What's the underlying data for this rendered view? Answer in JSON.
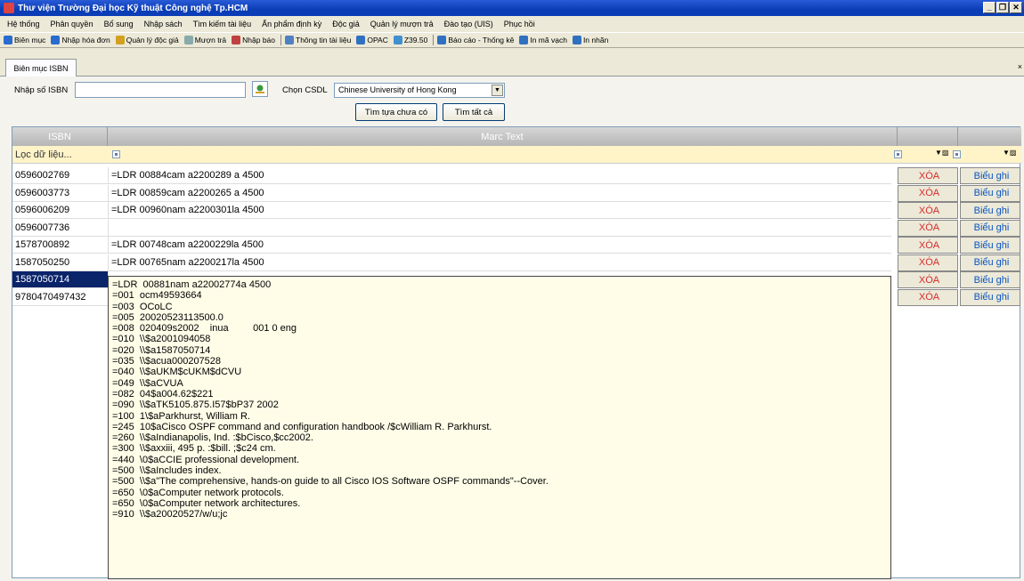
{
  "window": {
    "title": "Thư viện Trường Đại học Kỹ thuật Công nghệ Tp.HCM"
  },
  "menu": [
    "Hệ thống",
    "Phân quyền",
    "Bổ sung",
    "Nhập sách",
    "Tìm kiếm tài liệu",
    "Ấn phẩm định kỳ",
    "Độc giả",
    "Quản lý mượn trả",
    "Đào tạo (UIS)",
    "Phục hồi"
  ],
  "toolbar": [
    {
      "label": "Biên mục",
      "icon": "book-icon",
      "color": "#2a6bd0"
    },
    {
      "label": "Nhập hóa đơn",
      "icon": "invoice-icon",
      "color": "#2a6bd0"
    },
    {
      "label": "Quản lý độc giả",
      "icon": "users-icon",
      "color": "#d4a020"
    },
    {
      "label": "Mượn trả",
      "icon": "lend-icon",
      "color": "#8aa"
    },
    {
      "label": "Nhập báo",
      "icon": "newspaper-icon",
      "color": "#c04040"
    },
    {
      "label": "Thông tin tài liệu",
      "icon": "info-icon",
      "color": "#5080c0"
    },
    {
      "label": "OPAC",
      "icon": "search-icon",
      "color": "#3070c0"
    },
    {
      "label": "Z39.50",
      "icon": "globe-icon",
      "color": "#4090d0"
    },
    {
      "label": "Báo cáo - Thống kê",
      "icon": "report-icon",
      "color": "#3070c0"
    },
    {
      "label": "In mã vạch",
      "icon": "printer-icon",
      "color": "#3070c0"
    },
    {
      "label": "In nhãn",
      "icon": "printer-icon",
      "color": "#3070c0"
    }
  ],
  "tab": {
    "label": "Biên mục ISBN"
  },
  "form": {
    "isbn_label": "Nhập số ISBN",
    "isbn_value": "",
    "db_label": "Chọn CSDL",
    "db_value": "Chinese University of Hong Kong",
    "btn_find_missing": "Tìm tựa chưa có",
    "btn_find_all": "Tìm tất cả"
  },
  "grid": {
    "col_isbn": "ISBN",
    "col_marc": "Marc Text",
    "filter_placeholder": "Lọc dữ liệu...",
    "action_delete": "XÓA",
    "action_record": "Biểu ghi",
    "rows": [
      {
        "isbn": "0596002769",
        "marc": "=LDR  00884cam a2200289 a 4500"
      },
      {
        "isbn": "0596003773",
        "marc": "=LDR  00859cam a2200265 a 4500"
      },
      {
        "isbn": "0596006209",
        "marc": "=LDR  00960nam a2200301la 4500"
      },
      {
        "isbn": "0596007736",
        "marc": ""
      },
      {
        "isbn": "1578700892",
        "marc": "=LDR  00748cam a2200229la 4500"
      },
      {
        "isbn": "1587050250",
        "marc": "=LDR  00765nam a2200217la 4500"
      },
      {
        "isbn": "1587050714",
        "marc": ""
      },
      {
        "isbn": "9780470497432",
        "marc": ""
      }
    ],
    "expanded_marc": [
      "=LDR  00881nam a22002774a 4500",
      "=001  ocm49593664",
      "=003  OCoLC",
      "=005  20020523113500.0",
      "=008  020409s2002    inua         001 0 eng",
      "=010  \\\\$a2001094058",
      "=020  \\\\$a1587050714",
      "=035  \\\\$acua000207528",
      "=040  \\\\$aUKM$cUKM$dCVU",
      "=049  \\\\$aCVUA",
      "=082  04$a004.62$221",
      "=090  \\\\$aTK5105.875.I57$bP37 2002",
      "=100  1\\$aParkhurst, William R.",
      "=245  10$aCisco OSPF command and configuration handbook /$cWilliam R. Parkhurst.",
      "=260  \\\\$aIndianapolis, Ind. :$bCisco,$cc2002.",
      "=300  \\\\$axxiii, 495 p. :$bill. ;$c24 cm.",
      "=440  \\0$aCCIE professional development.",
      "=500  \\\\$aIncludes index.",
      "=500  \\\\$a\"The comprehensive, hands-on guide to all Cisco IOS Software OSPF commands\"--Cover.",
      "=650  \\0$aComputer network protocols.",
      "=650  \\0$aComputer network architectures.",
      "=910  \\\\$a20020527/w/u;jc"
    ]
  }
}
